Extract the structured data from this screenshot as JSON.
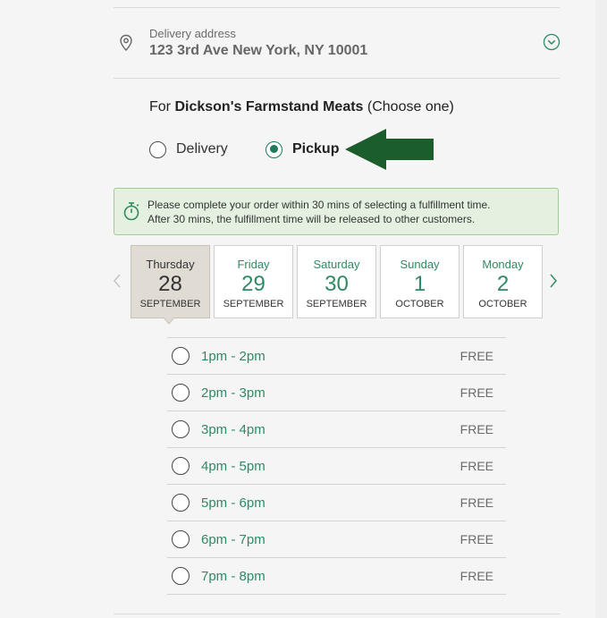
{
  "address": {
    "label": "Delivery address",
    "value": "123 3rd Ave New York, NY 10001",
    "pin_icon": "map-pin-icon",
    "expand_icon": "chevron-down-circle-icon"
  },
  "fulfillment": {
    "for_prefix": "For",
    "store": "Dickson's Farmstand Meats",
    "choose": "(Choose one)",
    "options": [
      {
        "label": "Delivery",
        "selected": false
      },
      {
        "label": "Pickup",
        "selected": true
      }
    ]
  },
  "notice": {
    "icon": "stopwatch-icon",
    "line1": "Please complete your order within 30 mins of selecting a fulfillment time.",
    "line2": "After 30 mins, the fulfillment time will be released to other customers."
  },
  "days": [
    {
      "weekday": "Thursday",
      "date": "28",
      "month": "SEPTEMBER",
      "selected": true
    },
    {
      "weekday": "Friday",
      "date": "29",
      "month": "SEPTEMBER",
      "selected": false
    },
    {
      "weekday": "Saturday",
      "date": "30",
      "month": "SEPTEMBER",
      "selected": false
    },
    {
      "weekday": "Sunday",
      "date": "1",
      "month": "OCTOBER",
      "selected": false
    },
    {
      "weekday": "Monday",
      "date": "2",
      "month": "OCTOBER",
      "selected": false
    }
  ],
  "slots": [
    {
      "time": "1pm - 2pm",
      "price": "FREE"
    },
    {
      "time": "2pm - 3pm",
      "price": "FREE"
    },
    {
      "time": "3pm - 4pm",
      "price": "FREE"
    },
    {
      "time": "4pm - 5pm",
      "price": "FREE"
    },
    {
      "time": "5pm - 6pm",
      "price": "FREE"
    },
    {
      "time": "6pm - 7pm",
      "price": "FREE"
    },
    {
      "time": "7pm - 8pm",
      "price": "FREE"
    }
  ],
  "colors": {
    "accent": "#2f8a64",
    "radio_selected": "#1f7a5a",
    "notice_bg": "#e4f1e1",
    "notice_border": "#9fcd96",
    "selected_day_bg": "#e0dcd4",
    "arrow": "#1b5e2b"
  }
}
